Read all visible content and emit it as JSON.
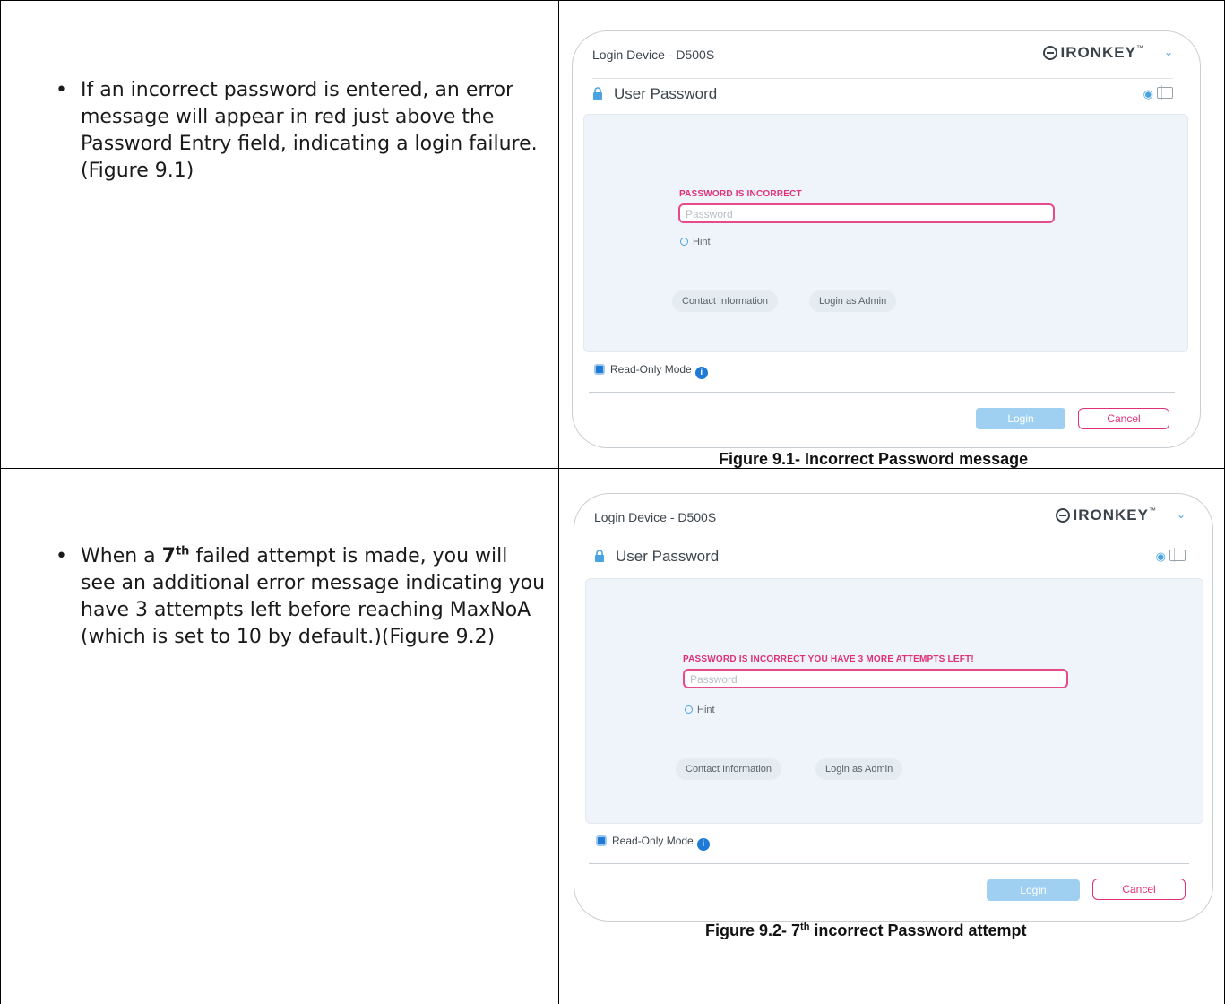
{
  "rows": [
    {
      "bullet": "If an incorrect password is entered, an error message will appear in red just above the Password Entry field, indicating a login failure. (Figure 9.1)",
      "caption": "Figure 9.1- Incorrect Password message",
      "dialog": {
        "title": "Login Device - D500S",
        "brand": "IRONKEY",
        "section_label": "User Password",
        "error_message": "PASSWORD IS INCORRECT",
        "password_placeholder": "Password",
        "hint_label": "Hint",
        "contact_button": "Contact Information",
        "admin_button": "Login as Admin",
        "read_only_label": "Read-Only Mode",
        "login_button": "Login",
        "cancel_button": "Cancel"
      }
    },
    {
      "bullet_parts": {
        "before": "When a ",
        "bold": "7",
        "sup": "th",
        "after": " failed attempt is made, you will see an additional error message indicating you have 3 attempts left before reaching MaxNoA (which is set to 10 by default.)(Figure 9.2)"
      },
      "caption_parts": {
        "before": "Figure 9.2- 7",
        "sup": "th",
        "after": " incorrect Password attempt"
      },
      "dialog": {
        "title": "Login Device - D500S",
        "brand": "IRONKEY",
        "section_label": "User Password",
        "error_message": "PASSWORD IS INCORRECT YOU HAVE 3 MORE ATTEMPTS LEFT!",
        "password_placeholder": "Password",
        "hint_label": "Hint",
        "contact_button": "Contact Information",
        "admin_button": "Login as Admin",
        "read_only_label": "Read-Only Mode",
        "login_button": "Login",
        "cancel_button": "Cancel"
      }
    }
  ],
  "colors": {
    "error": "#e0307a",
    "accent": "#1f7ad6",
    "panel": "#eef4f9"
  }
}
